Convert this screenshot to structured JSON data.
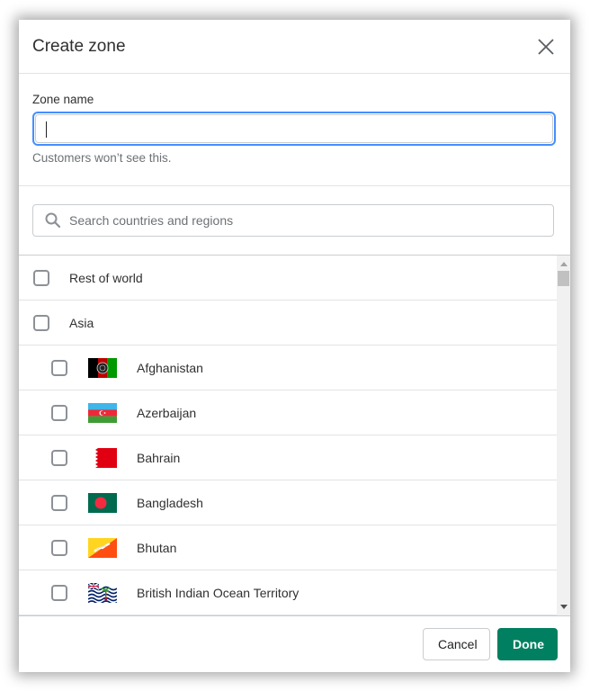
{
  "modal": {
    "title": "Create zone",
    "close_icon": "close-icon"
  },
  "zone_name": {
    "label": "Zone name",
    "value": "",
    "help_text": "Customers won’t see this."
  },
  "search": {
    "placeholder": "Search countries and regions",
    "value": "",
    "icon": "search-icon"
  },
  "list": {
    "groups": [
      {
        "label": "Rest of world",
        "checked": false
      },
      {
        "label": "Asia",
        "checked": false
      }
    ],
    "countries": [
      {
        "label": "Afghanistan",
        "flag": "afghanistan-flag-icon",
        "checked": false
      },
      {
        "label": "Azerbaijan",
        "flag": "azerbaijan-flag-icon",
        "checked": false
      },
      {
        "label": "Bahrain",
        "flag": "bahrain-flag-icon",
        "checked": false
      },
      {
        "label": "Bangladesh",
        "flag": "bangladesh-flag-icon",
        "checked": false
      },
      {
        "label": "Bhutan",
        "flag": "bhutan-flag-icon",
        "checked": false
      },
      {
        "label": "British Indian Ocean Territory",
        "flag": "british-indian-ocean-territory-flag-icon",
        "checked": false
      }
    ]
  },
  "footer": {
    "cancel_label": "Cancel",
    "done_label": "Done"
  },
  "colors": {
    "primary": "#008060",
    "focus_ring": "#458fff",
    "border": "#c9cccf",
    "subdued_text": "#6d7175"
  }
}
